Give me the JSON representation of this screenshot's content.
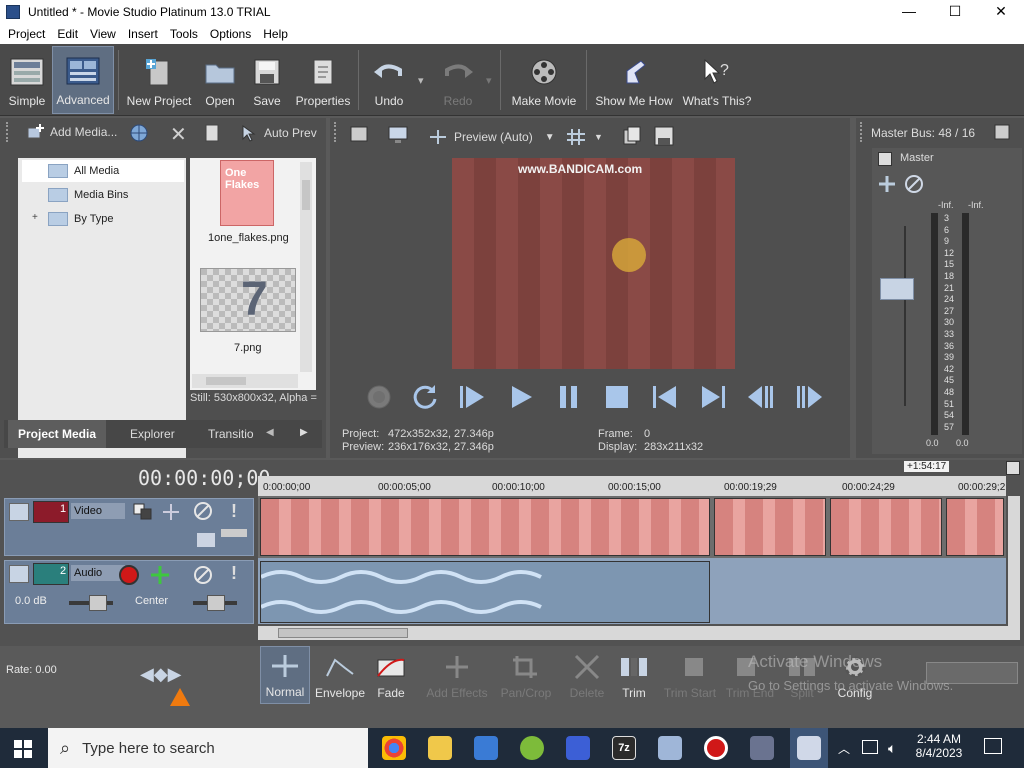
{
  "window": {
    "title": "Untitled * - Movie Studio Platinum 13.0 TRIAL"
  },
  "menu": [
    "Project",
    "Edit",
    "View",
    "Insert",
    "Tools",
    "Options",
    "Help"
  ],
  "toolbar": {
    "simple": "Simple",
    "advanced": "Advanced",
    "new_project": "New Project",
    "open": "Open",
    "save": "Save",
    "properties": "Properties",
    "undo": "Undo",
    "redo": "Redo",
    "make_movie": "Make Movie",
    "show_me_how": "Show Me How",
    "whats_this": "What's This?"
  },
  "media_panel": {
    "add_media": "Add Media...",
    "auto_preview": "Auto Prev",
    "tree": [
      "All Media",
      "Media Bins",
      "By Type"
    ],
    "files": [
      "1one_flakes.png",
      "7.png"
    ],
    "thumb_text": "One Flakes",
    "status": "Still: 530x800x32, Alpha =",
    "tabs": [
      "Project Media",
      "Explorer",
      "Transitio"
    ]
  },
  "preview": {
    "mode": "Preview (Auto)",
    "watermark": "www.BANDICAM.com",
    "project_label": "Project:",
    "project_value": "472x352x32, 27.346p",
    "preview_label": "Preview:",
    "preview_value": "236x176x32, 27.346p",
    "frame_label": "Frame:",
    "frame_value": "0",
    "display_label": "Display:",
    "display_value": "283x211x32"
  },
  "mixer": {
    "title": "Master Bus: 48 / 16",
    "master": "Master",
    "inf_left": "-Inf.",
    "inf_right": "-Inf.",
    "scale": [
      "3",
      "6",
      "9",
      "12",
      "15",
      "18",
      "21",
      "24",
      "27",
      "30",
      "33",
      "36",
      "39",
      "42",
      "45",
      "48",
      "51",
      "54",
      "57"
    ],
    "bottom_left": "0.0",
    "bottom_right": "0.0"
  },
  "timeline": {
    "timecode": "00:00:00;00",
    "length_badge": "+1:54:17",
    "ruler": [
      "0:00:00;00",
      "00:00:05;00",
      "00:00:10;00",
      "00:00:15;00",
      "00:00:19;29",
      "00:00:24;29",
      "00:00:29;2"
    ],
    "video_track": {
      "num": "1",
      "name": "Video"
    },
    "audio_track": {
      "num": "2",
      "name": "Audio",
      "volume": "0.0 dB",
      "pan": "Center"
    }
  },
  "edit_tools": {
    "normal": "Normal",
    "envelope": "Envelope",
    "fade": "Fade",
    "add_effects": "Add Effects",
    "pan_crop": "Pan/Crop",
    "delete": "Delete",
    "trim": "Trim",
    "trim_start": "Trim Start",
    "trim_end": "Trim End",
    "split": "Split",
    "config": "Config"
  },
  "status": {
    "rate": "Rate: 0.00"
  },
  "watermark": {
    "line1": "Activate Windows",
    "line2": "Go to Settings to activate Windows."
  },
  "taskbar": {
    "search_placeholder": "Type here to search",
    "time": "2:44 AM",
    "date": "8/4/2023"
  },
  "colors": {
    "accent_active": "#5f6e82",
    "record_red": "#d01818",
    "track_blue": "#6b7e98"
  }
}
